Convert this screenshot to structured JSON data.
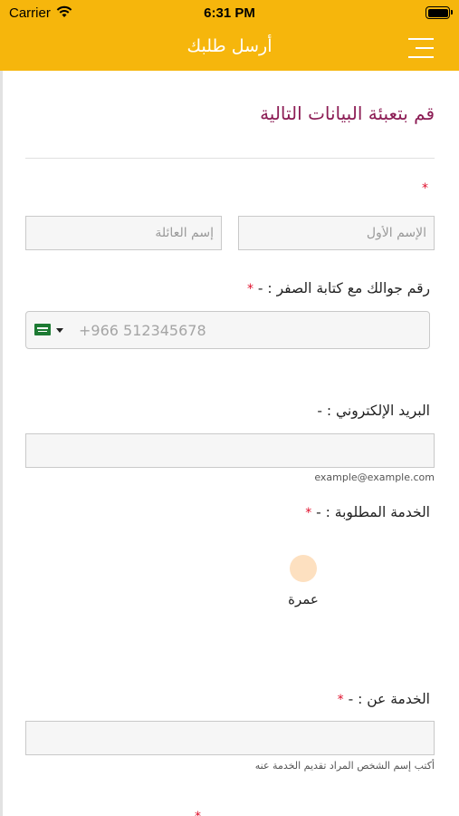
{
  "status_bar": {
    "carrier": "Carrier",
    "time": "6:31 PM",
    "wifi_icon": "wifi-icon",
    "battery_icon": "battery-icon"
  },
  "nav": {
    "title": "أرسل طلبك",
    "menu_icon": "menu-icon"
  },
  "colors": {
    "brand": "#f6b60c",
    "heading": "#8c1d55",
    "required": "#e0102c",
    "radio": "#fde0c0"
  },
  "form": {
    "heading": "قم بتعبئة البيانات التالية",
    "required_mark": "*",
    "name": {
      "first_placeholder": "الإسم الأول",
      "last_placeholder": "إسم العائلة"
    },
    "phone": {
      "label": "رقم جوالك مع كتابة الصفر : -",
      "placeholder": "+966 512345678",
      "country_flag": "saudi-flag-icon"
    },
    "email": {
      "label": "البريد الإلكتروني : -",
      "hint": "example@example.com"
    },
    "service": {
      "label": "الخدمة المطلوبة : -",
      "option": "عمرة"
    },
    "service_for": {
      "label": "الخدمة عن : -",
      "hint": "أكتب إسم الشخص المراد تقديم الخدمة عنه"
    }
  }
}
